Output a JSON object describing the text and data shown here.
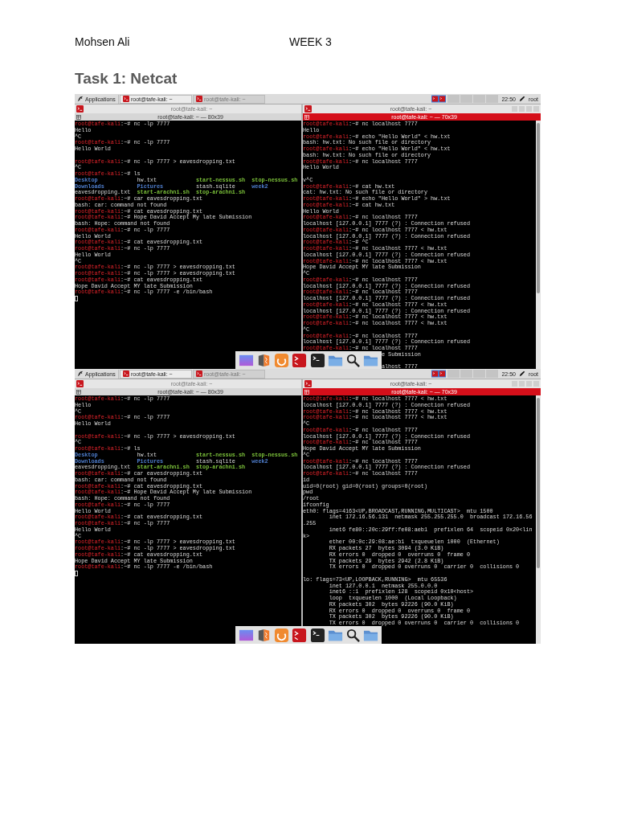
{
  "document": {
    "author": "Mohsen Ali",
    "week": "WEEK 3",
    "heading": "Task 1: Netcat"
  },
  "screenshots": [
    {
      "panel": {
        "menu": "Applications",
        "tasks": [
          {
            "label": "root@tafe-kali: ~",
            "selected": true
          },
          {
            "label": "root@tafe-kali: ~",
            "selected": false
          }
        ],
        "clock": "22:50",
        "user": "root"
      },
      "windows": [
        {
          "title": "root@tafe-kali: ~",
          "tab": "root@tafe-kali: ~ — 80x39",
          "active": false,
          "controls": false,
          "scrollbar": false,
          "lines": [
            {
              "kind": "prompt",
              "user": "root@tafe-kali",
              "path": ":~#",
              "cmd": "nc -lp 7777"
            },
            {
              "kind": "output",
              "text": "Hello"
            },
            {
              "kind": "output",
              "text": "^C"
            },
            {
              "kind": "prompt",
              "user": "root@tafe-kali",
              "path": ":~#",
              "cmd": "nc -lp 7777"
            },
            {
              "kind": "output",
              "text": "Hello World"
            },
            {
              "kind": "blank"
            },
            {
              "kind": "prompt",
              "user": "root@tafe-kali",
              "path": ":~#",
              "cmd": "nc -lp 7777 > eavesdropping.txt"
            },
            {
              "kind": "output",
              "text": "^C"
            },
            {
              "kind": "prompt",
              "user": "root@tafe-kali",
              "path": ":~#",
              "cmd": "ls"
            },
            {
              "kind": "files",
              "cells": [
                {
                  "text": "Desktop",
                  "kind": "directory"
                },
                {
                  "text": "hw.txt",
                  "kind": "file"
                },
                {
                  "text": "start-nessus.sh",
                  "kind": "script"
                },
                {
                  "text": "stop-nessus.sh",
                  "kind": "script"
                }
              ]
            },
            {
              "kind": "files",
              "cells": [
                {
                  "text": "Downloads",
                  "kind": "directory"
                },
                {
                  "text": "Pictures",
                  "kind": "directory"
                },
                {
                  "text": "stash.sqlite",
                  "kind": "file"
                },
                {
                  "text": "week2",
                  "kind": "directory"
                }
              ]
            },
            {
              "kind": "files",
              "cells": [
                {
                  "text": "eavesdropping.txt",
                  "kind": "file"
                },
                {
                  "text": "start-arachni.sh",
                  "kind": "script"
                },
                {
                  "text": "stop-arachni.sh",
                  "kind": "script"
                }
              ]
            },
            {
              "kind": "prompt",
              "user": "root@tafe-kali",
              "path": ":~#",
              "cmd": "car eavesdropping.txt"
            },
            {
              "kind": "output",
              "text": "bash: car: command not found"
            },
            {
              "kind": "prompt",
              "user": "root@tafe-kali",
              "path": ":~#",
              "cmd": "cat eavesdropping.txt"
            },
            {
              "kind": "prompt",
              "user": "root@tafe-kali",
              "path": ":~#",
              "cmd": "Hope David Accept My late Submission"
            },
            {
              "kind": "output",
              "text": "bash: Hope: command not found"
            },
            {
              "kind": "prompt",
              "user": "root@tafe-kali",
              "path": ":~#",
              "cmd": "nc -lp 7777"
            },
            {
              "kind": "output",
              "text": "Hello World"
            },
            {
              "kind": "prompt",
              "user": "root@tafe-kali",
              "path": ":~#",
              "cmd": "cat eavesdropping.txt"
            },
            {
              "kind": "prompt",
              "user": "root@tafe-kali",
              "path": ":~#",
              "cmd": "nc -lp 7777"
            },
            {
              "kind": "output",
              "text": "Hello World"
            },
            {
              "kind": "output",
              "text": "^C"
            },
            {
              "kind": "prompt",
              "user": "root@tafe-kali",
              "path": ":~#",
              "cmd": "nc -lp 7777 > eavesdropping.txt"
            },
            {
              "kind": "prompt",
              "user": "root@tafe-kali",
              "path": ":~#",
              "cmd": "nc -lp 7777 > eavesdropping.txt"
            },
            {
              "kind": "prompt",
              "user": "root@tafe-kali",
              "path": ":~#",
              "cmd": "cat eavesdropping.txt"
            },
            {
              "kind": "output",
              "text": "Hope David Accept MY late Submission"
            },
            {
              "kind": "prompt",
              "user": "root@tafe-kali",
              "path": ":~#",
              "cmd": "nc -lp 7777 -e /bin/bash"
            },
            {
              "kind": "cursor"
            }
          ]
        },
        {
          "title": "root@tafe-kali: ~",
          "tab": "root@tafe-kali: ~ — 70x39",
          "active": true,
          "controls": true,
          "scrollbar": true,
          "lines": [
            {
              "kind": "prompt",
              "user": "root@tafe-kali",
              "path": ":~#",
              "cmd": "nc localhost 7777"
            },
            {
              "kind": "output",
              "text": "Hello"
            },
            {
              "kind": "prompt",
              "user": "root@tafe-kali",
              "path": ":~#",
              "cmd": "echo \"Hello World\" < hw.txt"
            },
            {
              "kind": "output",
              "text": "bash: hw.txt: No such file or directory"
            },
            {
              "kind": "prompt",
              "user": "root@tafe-kali",
              "path": ":~#",
              "cmd": "echo \"Hello World\" < hw.txt"
            },
            {
              "kind": "output",
              "text": "bash: hw.txt: No such file or directory"
            },
            {
              "kind": "prompt",
              "user": "root@tafe-kali",
              "path": ":~#",
              "cmd": "nc localhost 7777"
            },
            {
              "kind": "output",
              "text": "Hello World"
            },
            {
              "kind": "blank"
            },
            {
              "kind": "output",
              "text": "v^C"
            },
            {
              "kind": "prompt",
              "user": "root@tafe-kali",
              "path": ":~#",
              "cmd": "cat hw.txt"
            },
            {
              "kind": "output",
              "text": "cat: hw.txt: No such file or directory"
            },
            {
              "kind": "prompt",
              "user": "root@tafe-kali",
              "path": ":~#",
              "cmd": "echo \"Hello World\" > hw.txt"
            },
            {
              "kind": "prompt",
              "user": "root@tafe-kali",
              "path": ":~#",
              "cmd": "cat hw.txt"
            },
            {
              "kind": "output",
              "text": "Hello World"
            },
            {
              "kind": "prompt",
              "user": "root@tafe-kali",
              "path": ":~#",
              "cmd": "nc localhost 7777"
            },
            {
              "kind": "output",
              "text": "localhost [127.0.0.1] 7777 (?) : Connection refused"
            },
            {
              "kind": "prompt",
              "user": "root@tafe-kali",
              "path": ":~#",
              "cmd": "nc localhost 7777 < hw.txt"
            },
            {
              "kind": "output",
              "text": "localhost [127.0.0.1] 7777 (?) : Connection refused"
            },
            {
              "kind": "prompt",
              "user": "root@tafe-kali",
              "path": ":~#",
              "cmd": "^C"
            },
            {
              "kind": "prompt",
              "user": "root@tafe-kali",
              "path": ":~#",
              "cmd": "nc localhost 7777 < hw.txt"
            },
            {
              "kind": "output",
              "text": "localhost [127.0.0.1] 7777 (?) : Connection refused"
            },
            {
              "kind": "prompt",
              "user": "root@tafe-kali",
              "path": ":~#",
              "cmd": "nc localhost 7777 < hw.txt"
            },
            {
              "kind": "output",
              "text": "Hope David Accept MY late Submission"
            },
            {
              "kind": "output",
              "text": "^C"
            },
            {
              "kind": "prompt",
              "user": "root@tafe-kali",
              "path": ":~#",
              "cmd": "nc localhost 7777"
            },
            {
              "kind": "output",
              "text": "localhost [127.0.0.1] 7777 (?) : Connection refused"
            },
            {
              "kind": "prompt",
              "user": "root@tafe-kali",
              "path": ":~#",
              "cmd": "nc localhost 7777"
            },
            {
              "kind": "output",
              "text": "localhost [127.0.0.1] 7777 (?) : Connection refused"
            },
            {
              "kind": "prompt",
              "user": "root@tafe-kali",
              "path": ":~#",
              "cmd": "nc localhost 7777 < hw.txt"
            },
            {
              "kind": "output",
              "text": "localhost [127.0.0.1] 7777 (?) : Connection refused"
            },
            {
              "kind": "prompt",
              "user": "root@tafe-kali",
              "path": ":~#",
              "cmd": "nc localhost 7777 < hw.txt"
            },
            {
              "kind": "prompt",
              "user": "root@tafe-kali",
              "path": ":~#",
              "cmd": "nc localhost 7777 < hw.txt"
            },
            {
              "kind": "output",
              "text": "^C"
            },
            {
              "kind": "prompt",
              "user": "root@tafe-kali",
              "path": ":~#",
              "cmd": "nc localhost 7777"
            },
            {
              "kind": "output",
              "text": "localhost [127.0.0.1] 7777 (?) : Connection refused"
            },
            {
              "kind": "prompt",
              "user": "root@tafe-kali",
              "path": ":~#",
              "cmd": "nc localhost 7777"
            },
            {
              "kind": "output",
              "text": "                        e Submission"
            },
            {
              "kind": "blank"
            },
            {
              "kind": "output",
              "text": "                        alhost 7777"
            }
          ]
        }
      ]
    },
    {
      "panel": {
        "menu": "Applications",
        "tasks": [
          {
            "label": "root@tafe-kali: ~",
            "selected": true
          },
          {
            "label": "root@tafe-kali: ~",
            "selected": false
          }
        ],
        "clock": "22:50",
        "user": "root"
      },
      "windows": [
        {
          "title": "root@tafe-kali: ~",
          "tab": "root@tafe-kali: ~ — 80x39",
          "active": false,
          "controls": false,
          "scrollbar": false,
          "lines": [
            {
              "kind": "prompt",
              "user": "root@tafe-kali",
              "path": ":~#",
              "cmd": "nc -lp 7777"
            },
            {
              "kind": "output",
              "text": "Hello"
            },
            {
              "kind": "output",
              "text": "^C"
            },
            {
              "kind": "prompt",
              "user": "root@tafe-kali",
              "path": ":~#",
              "cmd": "nc -lp 7777"
            },
            {
              "kind": "output",
              "text": "Hello World"
            },
            {
              "kind": "blank"
            },
            {
              "kind": "prompt",
              "user": "root@tafe-kali",
              "path": ":~#",
              "cmd": "nc -lp 7777 > eavesdropping.txt"
            },
            {
              "kind": "output",
              "text": "^C"
            },
            {
              "kind": "prompt",
              "user": "root@tafe-kali",
              "path": ":~#",
              "cmd": "ls"
            },
            {
              "kind": "files",
              "cells": [
                {
                  "text": "Desktop",
                  "kind": "directory"
                },
                {
                  "text": "hw.txt",
                  "kind": "file"
                },
                {
                  "text": "start-nessus.sh",
                  "kind": "script"
                },
                {
                  "text": "stop-nessus.sh",
                  "kind": "script"
                }
              ]
            },
            {
              "kind": "files",
              "cells": [
                {
                  "text": "Downloads",
                  "kind": "directory"
                },
                {
                  "text": "Pictures",
                  "kind": "directory"
                },
                {
                  "text": "stash.sqlite",
                  "kind": "file"
                },
                {
                  "text": "week2",
                  "kind": "directory"
                }
              ]
            },
            {
              "kind": "files",
              "cells": [
                {
                  "text": "eavesdropping.txt",
                  "kind": "file"
                },
                {
                  "text": "start-arachni.sh",
                  "kind": "script"
                },
                {
                  "text": "stop-arachni.sh",
                  "kind": "script"
                }
              ]
            },
            {
              "kind": "prompt",
              "user": "root@tafe-kali",
              "path": ":~#",
              "cmd": "car eavesdropping.txt"
            },
            {
              "kind": "output",
              "text": "bash: car: command not found"
            },
            {
              "kind": "prompt",
              "user": "root@tafe-kali",
              "path": ":~#",
              "cmd": "cat eavesdropping.txt"
            },
            {
              "kind": "prompt",
              "user": "root@tafe-kali",
              "path": ":~#",
              "cmd": "Hope David Accept My late Submission"
            },
            {
              "kind": "output",
              "text": "bash: Hope: command not found"
            },
            {
              "kind": "prompt",
              "user": "root@tafe-kali",
              "path": ":~#",
              "cmd": "nc -lp 7777"
            },
            {
              "kind": "output",
              "text": "Hello World"
            },
            {
              "kind": "prompt",
              "user": "root@tafe-kali",
              "path": ":~#",
              "cmd": "cat eavesdropping.txt"
            },
            {
              "kind": "prompt",
              "user": "root@tafe-kali",
              "path": ":~#",
              "cmd": "nc -lp 7777"
            },
            {
              "kind": "output",
              "text": "Hello World"
            },
            {
              "kind": "output",
              "text": "^C"
            },
            {
              "kind": "prompt",
              "user": "root@tafe-kali",
              "path": ":~#",
              "cmd": "nc -lp 7777 > eavesdropping.txt"
            },
            {
              "kind": "prompt",
              "user": "root@tafe-kali",
              "path": ":~#",
              "cmd": "nc -lp 7777 > eavesdropping.txt"
            },
            {
              "kind": "prompt",
              "user": "root@tafe-kali",
              "path": ":~#",
              "cmd": "cat eavesdropping.txt"
            },
            {
              "kind": "output",
              "text": "Hope David Accept MY late Submission"
            },
            {
              "kind": "prompt",
              "user": "root@tafe-kali",
              "path": ":~#",
              "cmd": "nc -lp 7777 -e /bin/bash"
            },
            {
              "kind": "cursor"
            }
          ]
        },
        {
          "title": "root@tafe-kali: ~",
          "tab": "root@tafe-kali: ~ — 70x39",
          "active": true,
          "controls": true,
          "scrollbar": true,
          "lines": [
            {
              "kind": "prompt",
              "user": "root@tafe-kali",
              "path": ":~#",
              "cmd": "nc localhost 7777 < hw.txt"
            },
            {
              "kind": "output",
              "text": "localhost [127.0.0.1] 7777 (?) : Connection refused"
            },
            {
              "kind": "prompt",
              "user": "root@tafe-kali",
              "path": ":~#",
              "cmd": "nc localhost 7777 < hw.txt"
            },
            {
              "kind": "prompt",
              "user": "root@tafe-kali",
              "path": ":~#",
              "cmd": "nc localhost 7777 < hw.txt"
            },
            {
              "kind": "output",
              "text": "^C"
            },
            {
              "kind": "prompt",
              "user": "root@tafe-kali",
              "path": ":~#",
              "cmd": "nc localhost 7777"
            },
            {
              "kind": "output",
              "text": "localhost [127.0.0.1] 7777 (?) : Connection refused"
            },
            {
              "kind": "prompt",
              "user": "root@tafe-kali",
              "path": ":~#",
              "cmd": "nc localhost 7777"
            },
            {
              "kind": "output",
              "text": "Hope David Accept MY late Submission"
            },
            {
              "kind": "output",
              "text": "^C"
            },
            {
              "kind": "prompt",
              "user": "root@tafe-kali",
              "path": ":~#",
              "cmd": "nc localhost 7777"
            },
            {
              "kind": "output",
              "text": "localhost [127.0.0.1] 7777 (?) : Connection refused"
            },
            {
              "kind": "prompt",
              "user": "root@tafe-kali",
              "path": ":~#",
              "cmd": "nc localhost 7777"
            },
            {
              "kind": "output",
              "text": "id"
            },
            {
              "kind": "output",
              "text": "uid=0(root) gid=0(root) groups=0(root)"
            },
            {
              "kind": "output",
              "text": "pwd"
            },
            {
              "kind": "output",
              "text": "/root"
            },
            {
              "kind": "output",
              "text": "ifconfig"
            },
            {
              "kind": "output",
              "text": "eth0: flags=4163<UP,BROADCAST,RUNNING,MULTICAST>  mtu 1500"
            },
            {
              "kind": "output",
              "text": "        inet 172.16.56.131  netmask 255.255.255.0  broadcast 172.16.56"
            },
            {
              "kind": "output",
              "text": ".255"
            },
            {
              "kind": "output",
              "text": "        inet6 fe80::20c:29ff:fe08:aeb1  prefixlen 64  scopeid 0x20<lin"
            },
            {
              "kind": "output",
              "text": "k>"
            },
            {
              "kind": "output",
              "text": "        ether 00:0c:29:08:ae:b1  txqueuelen 1000  (Ethernet)"
            },
            {
              "kind": "output",
              "text": "        RX packets 27  bytes 3094 (3.0 KiB)"
            },
            {
              "kind": "output",
              "text": "        RX errors 0  dropped 0  overruns 0  frame 0"
            },
            {
              "kind": "output",
              "text": "        TX packets 29  bytes 2942 (2.8 KiB)"
            },
            {
              "kind": "output",
              "text": "        TX errors 0  dropped 0 overruns 0  carrier 0  collisions 0"
            },
            {
              "kind": "blank"
            },
            {
              "kind": "output",
              "text": "lo: flags=73<UP,LOOPBACK,RUNNING>  mtu 65536"
            },
            {
              "kind": "output",
              "text": "        inet 127.0.0.1  netmask 255.0.0.0"
            },
            {
              "kind": "output",
              "text": "        inet6 ::1  prefixlen 128  scopeid 0x10<host>"
            },
            {
              "kind": "output",
              "text": "        loop  txqueuelen 1000  (Local Loopback)"
            },
            {
              "kind": "output",
              "text": "        RX packets 302  bytes 92226 (90.0 KiB)"
            },
            {
              "kind": "output",
              "text": "        RX errors 0  dropped 0  overruns 0  frame 0"
            },
            {
              "kind": "output",
              "text": "        TX packets 302  bytes 92226 (90.0 KiB)"
            },
            {
              "kind": "output",
              "text": "        TX errors 0  dropped 0 overruns 0  carrier 0  collisions 0"
            }
          ]
        }
      ]
    }
  ]
}
